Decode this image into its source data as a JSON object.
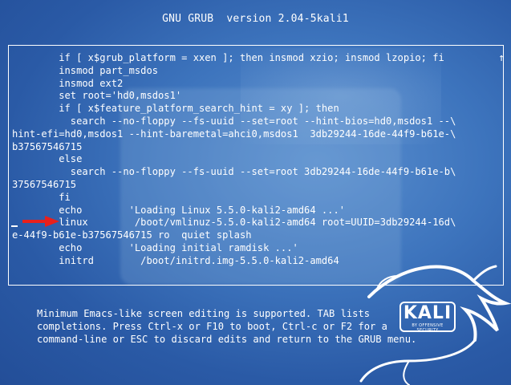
{
  "title": "GNU GRUB  version 2.04-5kali1",
  "editor": {
    "lines": [
      "        if [ x$grub_platform = xxen ]; then insmod xzio; insmod lzopio; fi",
      "        insmod part_msdos",
      "        insmod ext2",
      "        set root='hd0,msdos1'",
      "        if [ x$feature_platform_search_hint = xy ]; then",
      "          search --no-floppy --fs-uuid --set=root --hint-bios=hd0,msdos1 --\\",
      "hint-efi=hd0,msdos1 --hint-baremetal=ahci0,msdos1  3db29244-16de-44f9-b61e-\\",
      "b37567546715",
      "        else",
      "          search --no-floppy --fs-uuid --set=root 3db29244-16de-44f9-b61e-b\\",
      "37567546715",
      "        fi",
      "        echo        'Loading Linux 5.5.0-kali2-amd64 ...'",
      "        linux        /boot/vmlinuz-5.5.0-kali2-amd64 root=UUID=3db29244-16d\\",
      "e-44f9-b61e-b37567546715 ro  quiet splash",
      "        echo        'Loading initial ramdisk ...'",
      "        initrd        /boot/initrd.img-5.5.0-kali2-amd64"
    ],
    "scroll_indicator": "↑"
  },
  "help": {
    "lines": [
      "Minimum Emacs-like screen editing is supported. TAB lists",
      "completions. Press Ctrl-x or F10 to boot, Ctrl-c or F2 for a",
      "command-line or ESC to discard edits and return to the GRUB menu."
    ]
  },
  "logo": {
    "word": "KALI",
    "tagline": "BY OFFENSIVE SECURITY"
  },
  "colors": {
    "background": "#2f64b0",
    "text": "#ffffff",
    "arrow": "#e8201c"
  }
}
